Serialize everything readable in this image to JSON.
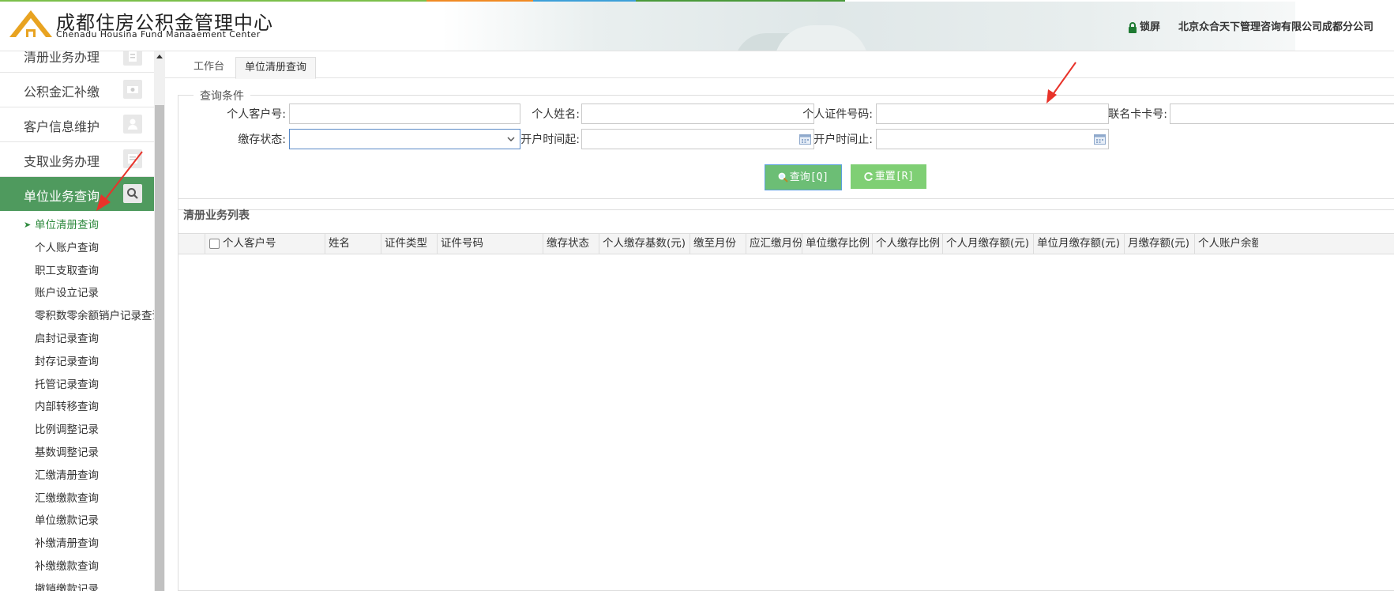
{
  "header": {
    "logo_cn": "成都住房公积金管理中心",
    "logo_en": "Chenadu  Housina Fund Manaaement Center",
    "lock_label": "锁屏",
    "company": "北京众合天下管理咨询有限公司成都分公司"
  },
  "colors": {
    "brand_orange": "#e8a321",
    "active_green": "#4f9a5e",
    "button_green": "#6cbe75",
    "annotation_red": "#e8332a"
  },
  "sidebar": {
    "menu": [
      {
        "label": "清册业务办理",
        "icon": "document-icon"
      },
      {
        "label": "公积金汇补缴",
        "icon": "money-icon"
      },
      {
        "label": "客户信息维护",
        "icon": "user-icon"
      },
      {
        "label": "支取业务办理",
        "icon": "list-icon"
      },
      {
        "label": "单位业务查询",
        "icon": "search-icon"
      }
    ],
    "submenu": [
      "单位清册查询",
      "个人账户查询",
      "职工支取查询",
      "账户设立记录",
      "零积数零余额销户记录查询",
      "启封记录查询",
      "封存记录查询",
      "托管记录查询",
      "内部转移查询",
      "比例调整记录",
      "基数调整记录",
      "汇缴清册查询",
      "汇缴缴款查询",
      "单位缴款记录",
      "补缴清册查询",
      "补缴缴款查询",
      "撤销缴款记录"
    ]
  },
  "tabs": {
    "home": "工作台",
    "current": "单位清册查询"
  },
  "query": {
    "legend": "查询条件",
    "personal_no_label": "个人客户号:",
    "name_label": "个人姓名:",
    "id_no_label": "个人证件号码:",
    "card_no_label": "联名卡卡号:",
    "status_label": "缴存状态:",
    "open_from_label": "开户时间起:",
    "open_to_label": "开户时间止:",
    "status_value": "",
    "query_button": "查询[Q]",
    "reset_button": "重置[R]"
  },
  "grid": {
    "title": "清册业务列表",
    "columns": [
      "个人客户号",
      "姓名",
      "证件类型",
      "证件号码",
      "缴存状态",
      "个人缴存基数(元)",
      "缴至月份",
      "应汇缴月份",
      "单位缴存比例",
      "个人缴存比例",
      "个人月缴存额(元)",
      "单位月缴存额(元)",
      "月缴存额(元)",
      "个人账户余额"
    ],
    "rows": []
  }
}
